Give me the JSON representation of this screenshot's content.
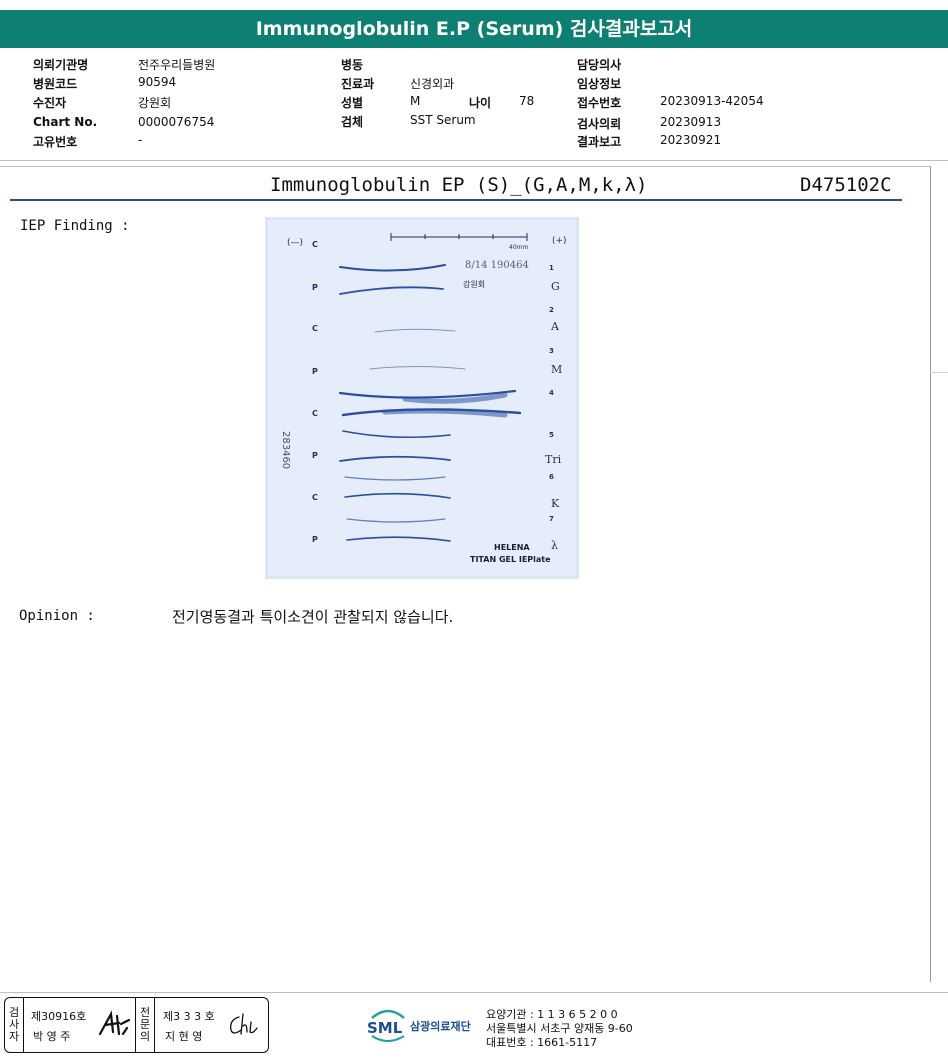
{
  "report_title": "Immunoglobulin E.P (Serum) 검사결과보고서",
  "meta": {
    "col1": [
      {
        "label": "의뢰기관명",
        "value": "전주우리들병원"
      },
      {
        "label": "병원코드",
        "value": "90594"
      },
      {
        "label": "수진자",
        "value": "강원회"
      },
      {
        "label": "Chart No.",
        "value": "0000076754"
      },
      {
        "label": "고유번호",
        "value": "-"
      }
    ],
    "col2": [
      {
        "label": "병동",
        "value": ""
      },
      {
        "label": "진료과",
        "value": "신경외과"
      },
      {
        "label": "성별",
        "value": "M"
      },
      {
        "label": "검체",
        "value": "SST Serum"
      }
    ],
    "age_label": "나이",
    "age_value": "78",
    "col3": [
      {
        "label": "담당의사",
        "value": ""
      },
      {
        "label": "임상정보",
        "value": ""
      },
      {
        "label": "접수번호",
        "value": "20230913-42054"
      },
      {
        "label": "검사의뢰",
        "value": "20230913"
      },
      {
        "label": "결과보고",
        "value": "20230921"
      }
    ]
  },
  "test": {
    "name": "Immunoglobulin EP (S)_(G,A,M,k,λ)",
    "code": "D475102C",
    "finding_label": "IEP Finding :",
    "opinion_label": "Opinion :",
    "opinion_text": "전기영동결과 특이소견이 관찰되지 않습니다."
  },
  "gel": {
    "minus": "(—)",
    "plus": "(+)",
    "scale": "40mm",
    "date": "8/14 190464",
    "name": "강원회",
    "side_number": "283460",
    "left_labels": [
      "C",
      "P",
      "C",
      "P",
      "C",
      "P",
      "C",
      "P"
    ],
    "right_numbers": [
      "1",
      "2",
      "3",
      "4",
      "5",
      "6",
      "7"
    ],
    "right_letters": [
      "G",
      "A",
      "M",
      "Tri",
      "K",
      "λ"
    ],
    "brand1": "HELENA",
    "brand2": "TITAN GEL IEPlate",
    "ink_color": "#2b4fa0",
    "background": "#dbe7f7"
  },
  "footer": {
    "inspector_role": [
      "검",
      "사",
      "자"
    ],
    "inspector_license": "제30916호",
    "inspector_name": "박 영 주",
    "doctor_role": [
      "전",
      "문",
      "의"
    ],
    "doctor_license": "제3 3 3 호",
    "doctor_name": "지 현 영",
    "logo_text": "SML",
    "org_name": "삼광의료재단",
    "code_line": "요양기관 : 1 1 3 6 5 2 0 0",
    "address_line": "서울특별시 서초구 양재동 9-60",
    "phone_line": "대표번호 : 1661-5117"
  }
}
